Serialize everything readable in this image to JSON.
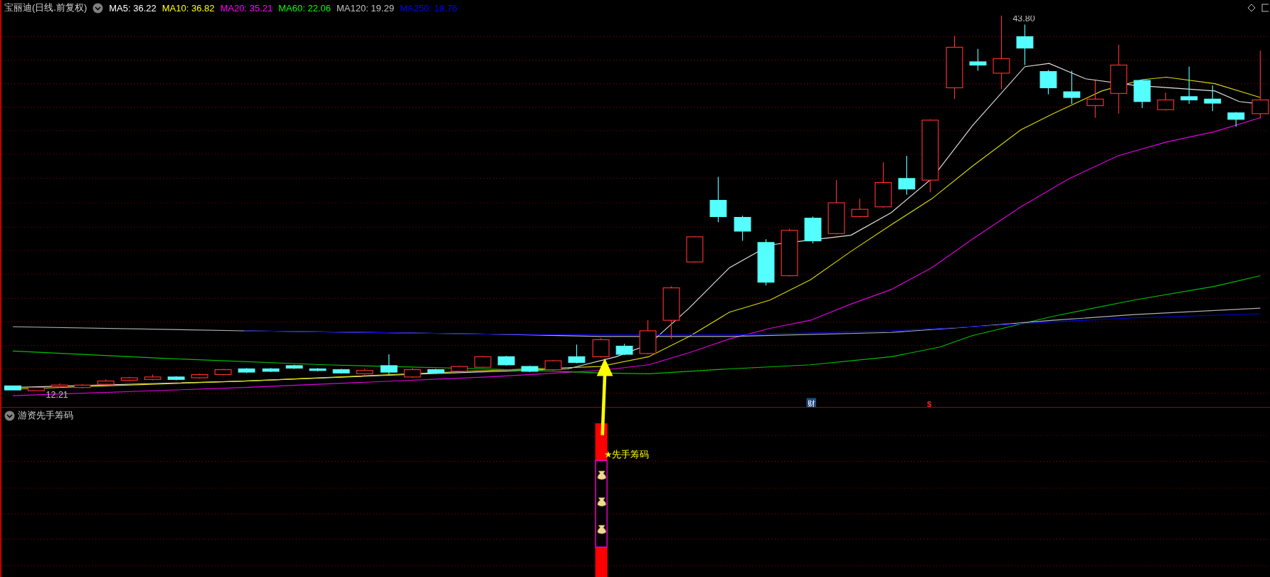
{
  "header": {
    "title": "宝丽迪(日线.前复权)",
    "moving_averages": [
      {
        "label": "MA5: 36.22",
        "color": "#ffffff"
      },
      {
        "label": "MA10: 36.82",
        "color": "#ffff00"
      },
      {
        "label": "MA20: 35.21",
        "color": "#ff00ff"
      },
      {
        "label": "MA60: 22.06",
        "color": "#00ff00"
      },
      {
        "label": "MA120: 19.29",
        "color": "#c0c0c0"
      },
      {
        "label": "MA250: 18.76",
        "color": "#0000ff"
      }
    ]
  },
  "price_chart": {
    "high_label": "43.80",
    "low_label": "12.21",
    "markers": [
      {
        "kind": "badge",
        "text": "财"
      },
      {
        "kind": "plain",
        "text": "$"
      }
    ]
  },
  "indicator": {
    "title": "游资先手筹码",
    "signal_label": "★先手筹码"
  }
}
